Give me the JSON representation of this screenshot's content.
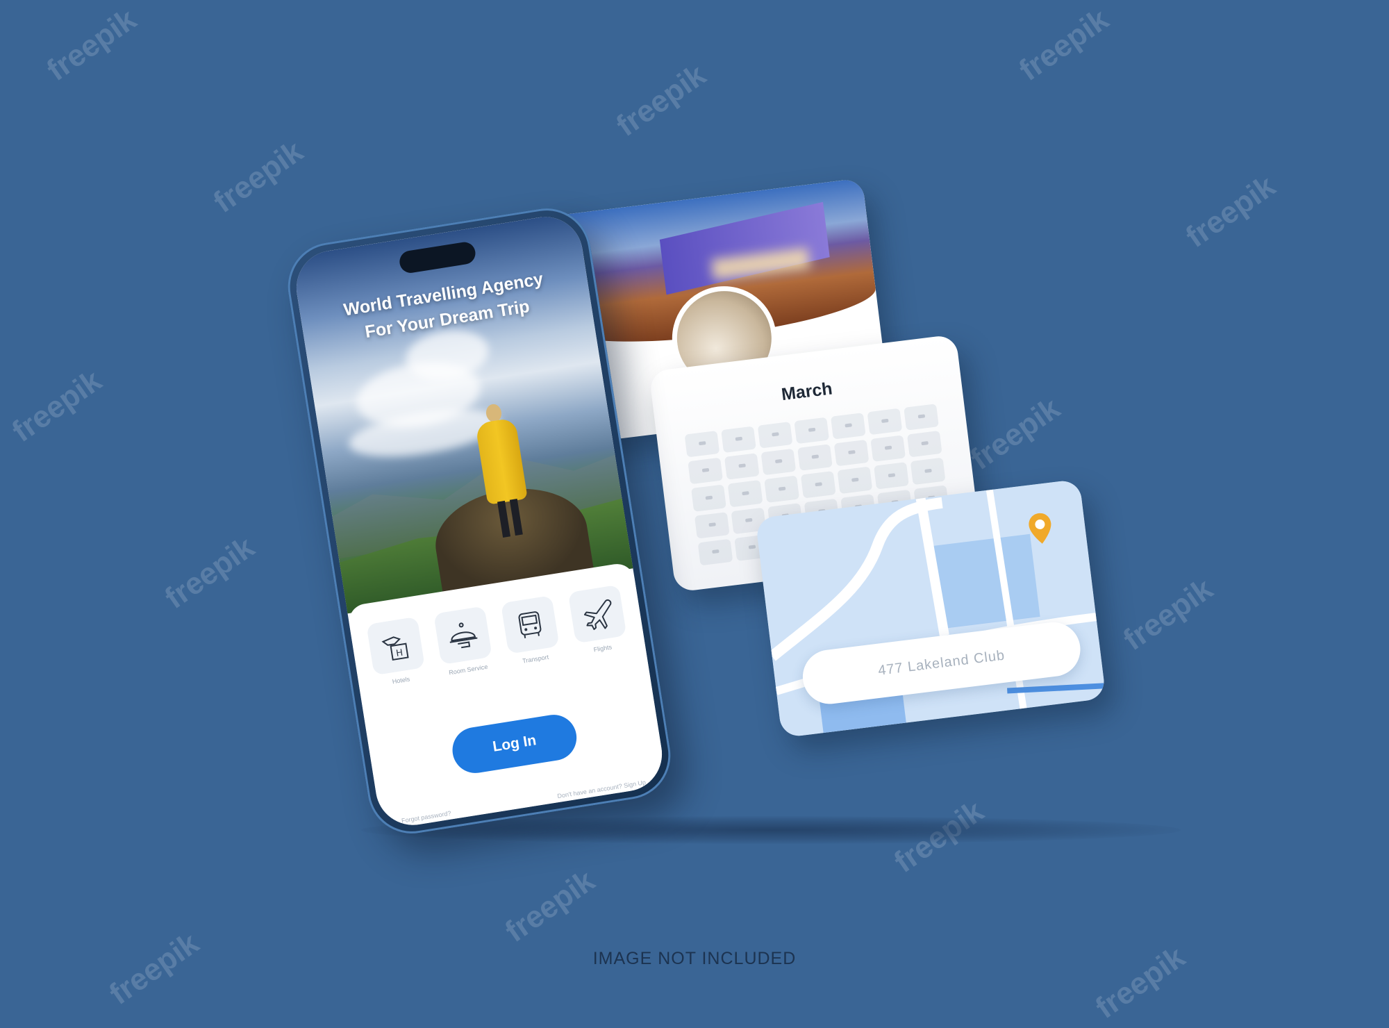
{
  "hero": {
    "title_line1": "World Travelling Agency",
    "title_line2": "For Your Dream Trip"
  },
  "categories": [
    {
      "label": "Hotels",
      "icon": "hotel-icon"
    },
    {
      "label": "Room Service",
      "icon": "food-cloche-icon"
    },
    {
      "label": "Transport",
      "icon": "bus-icon"
    },
    {
      "label": "Flights",
      "icon": "airplane-icon"
    }
  ],
  "login_label": "Log In",
  "footer_links": {
    "left": "Forgot password?",
    "right": "Don't have an account? Sign Up"
  },
  "calendar": {
    "month": "March"
  },
  "map": {
    "search_text": "477 Lakeland Club"
  },
  "caption": "IMAGE NOT INCLUDED",
  "watermark": "freepik",
  "colors": {
    "background": "#3a6595",
    "accent": "#1f7ae0",
    "coat": "#f2c623",
    "map_pin": "#f0a92a"
  }
}
